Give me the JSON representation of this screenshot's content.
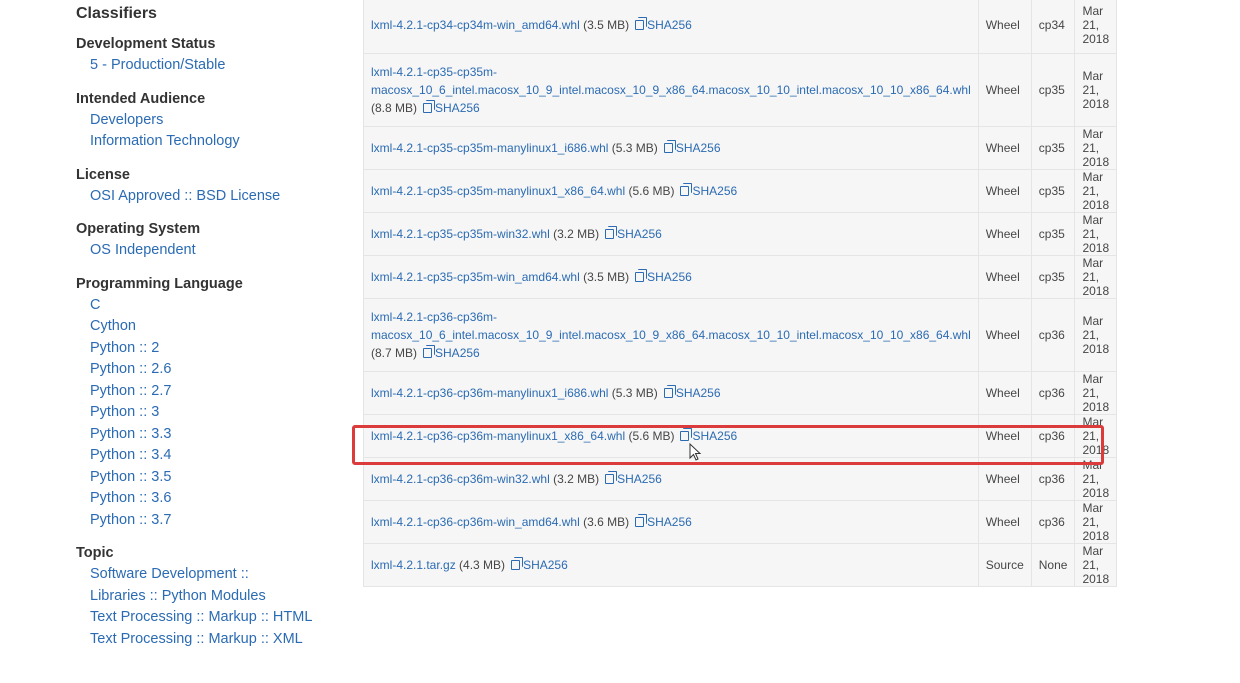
{
  "sidebar": {
    "title": "Classifiers",
    "groups": [
      {
        "heading": "Development Status",
        "items": [
          "5 - Production/Stable"
        ]
      },
      {
        "heading": "Intended Audience",
        "items": [
          "Developers",
          "Information Technology"
        ]
      },
      {
        "heading": "License",
        "items": [
          "OSI Approved :: BSD License"
        ]
      },
      {
        "heading": "Operating System",
        "items": [
          "OS Independent"
        ]
      },
      {
        "heading": "Programming Language",
        "items": [
          "C",
          "Cython",
          "Python :: 2",
          "Python :: 2.6",
          "Python :: 2.7",
          "Python :: 3",
          "Python :: 3.3",
          "Python :: 3.4",
          "Python :: 3.5",
          "Python :: 3.6",
          "Python :: 3.7"
        ]
      },
      {
        "heading": "Topic",
        "items": [
          "Software Development ::",
          "Libraries :: Python Modules",
          "Text Processing :: Markup :: HTML",
          "Text Processing :: Markup :: XML"
        ]
      }
    ]
  },
  "files": {
    "sha_label": "SHA256",
    "rows": [
      {
        "name": "lxml-4.2.1-cp34-cp34m-win_amd64.whl",
        "size": "(3.5 MB)",
        "type": "Wheel",
        "python": "cp34",
        "date": "Mar 21, 2018"
      },
      {
        "name": "lxml-4.2.1-cp35-cp35m-macosx_10_6_intel.macosx_10_9_intel.macosx_10_9_x86_64.macosx_10_10_intel.macosx_10_10_x86_64.whl",
        "size": "(8.8 MB)",
        "type": "Wheel",
        "python": "cp35",
        "date": "Mar 21, 2018"
      },
      {
        "name": "lxml-4.2.1-cp35-cp35m-manylinux1_i686.whl",
        "size": "(5.3 MB)",
        "type": "Wheel",
        "python": "cp35",
        "date": "Mar 21, 2018"
      },
      {
        "name": "lxml-4.2.1-cp35-cp35m-manylinux1_x86_64.whl",
        "size": "(5.6 MB)",
        "type": "Wheel",
        "python": "cp35",
        "date": "Mar 21, 2018"
      },
      {
        "name": "lxml-4.2.1-cp35-cp35m-win32.whl",
        "size": "(3.2 MB)",
        "type": "Wheel",
        "python": "cp35",
        "date": "Mar 21, 2018"
      },
      {
        "name": "lxml-4.2.1-cp35-cp35m-win_amd64.whl",
        "size": "(3.5 MB)",
        "type": "Wheel",
        "python": "cp35",
        "date": "Mar 21, 2018"
      },
      {
        "name": "lxml-4.2.1-cp36-cp36m-macosx_10_6_intel.macosx_10_9_intel.macosx_10_9_x86_64.macosx_10_10_intel.macosx_10_10_x86_64.whl",
        "size": "(8.7 MB)",
        "type": "Wheel",
        "python": "cp36",
        "date": "Mar 21, 2018"
      },
      {
        "name": "lxml-4.2.1-cp36-cp36m-manylinux1_i686.whl",
        "size": "(5.3 MB)",
        "type": "Wheel",
        "python": "cp36",
        "date": "Mar 21, 2018"
      },
      {
        "name": "lxml-4.2.1-cp36-cp36m-manylinux1_x86_64.whl",
        "size": "(5.6 MB)",
        "type": "Wheel",
        "python": "cp36",
        "date": "Mar 21, 2018"
      },
      {
        "name": "lxml-4.2.1-cp36-cp36m-win32.whl",
        "size": "(3.2 MB)",
        "type": "Wheel",
        "python": "cp36",
        "date": "Mar 21, 2018"
      },
      {
        "name": "lxml-4.2.1-cp36-cp36m-win_amd64.whl",
        "size": "(3.6 MB)",
        "type": "Wheel",
        "python": "cp36",
        "date": "Mar 21, 2018"
      },
      {
        "name": "lxml-4.2.1.tar.gz",
        "size": "(4.3 MB)",
        "type": "Source",
        "python": "None",
        "date": "Mar 21, 2018"
      }
    ]
  },
  "highlight": {
    "color": "#dc3b3b"
  },
  "colors": {
    "link": "#2b6bb3",
    "row_bg": "#f6f6f6"
  }
}
